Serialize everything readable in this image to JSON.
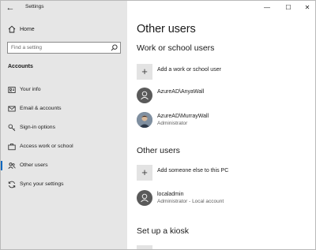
{
  "window": {
    "app_title": "Settings",
    "controls": {
      "minimize": "—",
      "maximize": "☐",
      "close": "✕"
    }
  },
  "sidebar": {
    "home_label": "Home",
    "search_placeholder": "Find a setting",
    "section_title": "Accounts",
    "items": [
      {
        "label": "Your info",
        "icon": "person-card-icon",
        "active": false
      },
      {
        "label": "Email & accounts",
        "icon": "mail-icon",
        "active": false
      },
      {
        "label": "Sign-in options",
        "icon": "key-icon",
        "active": false
      },
      {
        "label": "Access work or school",
        "icon": "briefcase-icon",
        "active": false
      },
      {
        "label": "Other users",
        "icon": "people-icon",
        "active": true
      },
      {
        "label": "Sync your settings",
        "icon": "sync-icon",
        "active": false
      }
    ]
  },
  "main": {
    "page_title": "Other users",
    "work_section": {
      "heading": "Work or school users",
      "add_label": "Add a work or school user",
      "users": [
        {
          "name": "AzureAD\\AnyaWall",
          "role": ""
        },
        {
          "name": "AzureAD\\MurrayWall",
          "role": "Administrator"
        }
      ]
    },
    "other_section": {
      "heading": "Other users",
      "add_label": "Add someone else to this PC",
      "users": [
        {
          "name": "localadmin",
          "role": "Administrator - Local account"
        }
      ]
    },
    "kiosk_section": {
      "heading": "Set up a kiosk"
    }
  },
  "colors": {
    "sidebar_bg": "#e6e6e6",
    "accent": "#0067c0",
    "tile_bg": "#e3e3e3"
  }
}
